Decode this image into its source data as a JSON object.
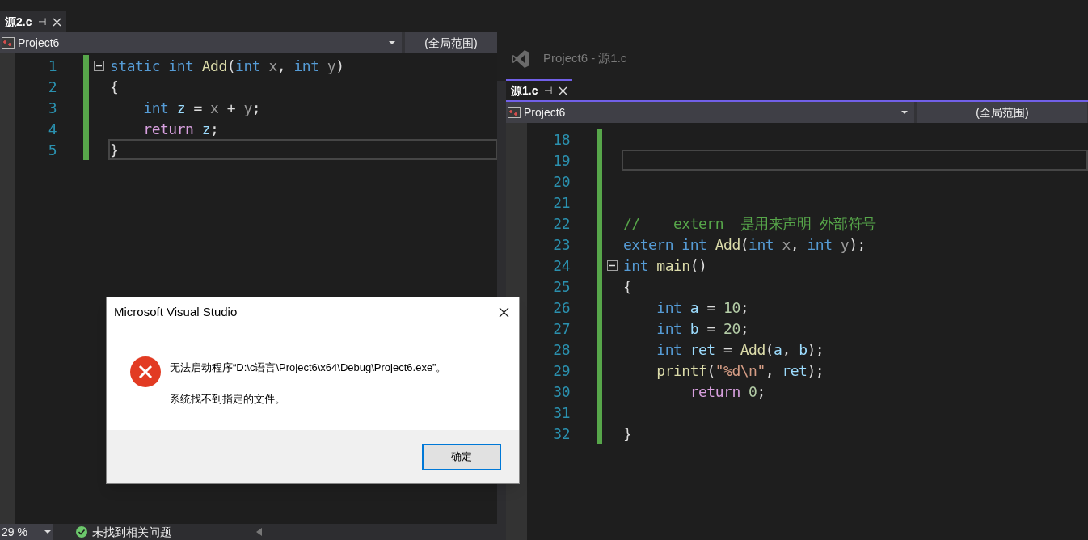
{
  "left_window": {
    "tab": {
      "label": "源2.c",
      "pin": "⊣",
      "selected": true
    },
    "nav": {
      "project": "Project6",
      "scope": "(全局范围)"
    },
    "lines": [
      {
        "number": "1",
        "fold": true,
        "current": false,
        "tokens": [
          {
            "kind": "keyword",
            "text": "static"
          },
          {
            "kind": "keyword",
            "text": " int"
          },
          {
            "kind": "function",
            "text": " Add"
          },
          {
            "kind": "plain",
            "text": "("
          },
          {
            "kind": "keyword",
            "text": "int"
          },
          {
            "kind": "param",
            "text": " x"
          },
          {
            "kind": "plain",
            "text": ", "
          },
          {
            "kind": "keyword",
            "text": "int"
          },
          {
            "kind": "param",
            "text": " y"
          },
          {
            "kind": "plain",
            "text": ")"
          }
        ]
      },
      {
        "number": "2",
        "fold": false,
        "current": false,
        "tokens": [
          {
            "kind": "plain",
            "text": "{"
          }
        ]
      },
      {
        "number": "3",
        "fold": false,
        "current": false,
        "tokens": [
          {
            "kind": "keyword",
            "text": "    int"
          },
          {
            "kind": "variable",
            "text": " z"
          },
          {
            "kind": "plain",
            "text": " = "
          },
          {
            "kind": "param",
            "text": "x"
          },
          {
            "kind": "plain",
            "text": " + "
          },
          {
            "kind": "param",
            "text": "y"
          },
          {
            "kind": "plain",
            "text": ";"
          }
        ]
      },
      {
        "number": "4",
        "fold": false,
        "current": false,
        "tokens": [
          {
            "kind": "control",
            "text": "    return"
          },
          {
            "kind": "variable",
            "text": " z"
          },
          {
            "kind": "plain",
            "text": ";"
          }
        ]
      },
      {
        "number": "5",
        "fold": false,
        "current": true,
        "tokens": [
          {
            "kind": "plain",
            "text": "}"
          }
        ]
      }
    ],
    "status": {
      "zoom": "29 %",
      "issues": "未找到相关问题"
    }
  },
  "right_window": {
    "title": "Project6 - 源1.c",
    "tab": {
      "label": "源1.c",
      "pin": "⊣",
      "selected": true
    },
    "nav": {
      "project": "Project6",
      "scope": "(全局范围)"
    },
    "lines": [
      {
        "number": "18",
        "fold": false,
        "current": false
      },
      {
        "number": "19",
        "fold": false,
        "current": true
      },
      {
        "number": "20",
        "fold": false,
        "current": false
      },
      {
        "number": "21",
        "fold": false,
        "current": false
      },
      {
        "number": "22",
        "fold": false,
        "current": false,
        "tokens": [
          {
            "kind": "comment",
            "text": "//    extern  是用来声明 外部符号"
          }
        ]
      },
      {
        "number": "23",
        "fold": false,
        "current": false,
        "tokens": [
          {
            "kind": "keyword",
            "text": "extern"
          },
          {
            "kind": "keyword",
            "text": " int"
          },
          {
            "kind": "function",
            "text": " Add"
          },
          {
            "kind": "plain",
            "text": "("
          },
          {
            "kind": "keyword",
            "text": "int"
          },
          {
            "kind": "param",
            "text": " x"
          },
          {
            "kind": "plain",
            "text": ", "
          },
          {
            "kind": "keyword",
            "text": "int"
          },
          {
            "kind": "param",
            "text": " y"
          },
          {
            "kind": "plain",
            "text": ");"
          }
        ]
      },
      {
        "number": "24",
        "fold": true,
        "current": false,
        "tokens": [
          {
            "kind": "keyword",
            "text": "int"
          },
          {
            "kind": "function",
            "text": " main"
          },
          {
            "kind": "plain",
            "text": "()"
          }
        ]
      },
      {
        "number": "25",
        "fold": false,
        "current": false,
        "tokens": [
          {
            "kind": "plain",
            "text": "{"
          }
        ]
      },
      {
        "number": "26",
        "fold": false,
        "current": false,
        "tokens": [
          {
            "kind": "keyword",
            "text": "    int"
          },
          {
            "kind": "variable",
            "text": " a"
          },
          {
            "kind": "plain",
            "text": " = "
          },
          {
            "kind": "number",
            "text": "10"
          },
          {
            "kind": "plain",
            "text": ";"
          }
        ]
      },
      {
        "number": "27",
        "fold": false,
        "current": false,
        "tokens": [
          {
            "kind": "keyword",
            "text": "    int"
          },
          {
            "kind": "variable",
            "text": " b"
          },
          {
            "kind": "plain",
            "text": " = "
          },
          {
            "kind": "number",
            "text": "20"
          },
          {
            "kind": "plain",
            "text": ";"
          }
        ]
      },
      {
        "number": "28",
        "fold": false,
        "current": false,
        "tokens": [
          {
            "kind": "keyword",
            "text": "    int"
          },
          {
            "kind": "variable",
            "text": " ret"
          },
          {
            "kind": "plain",
            "text": " = "
          },
          {
            "kind": "function",
            "text": "Add"
          },
          {
            "kind": "plain",
            "text": "("
          },
          {
            "kind": "variable",
            "text": "a"
          },
          {
            "kind": "plain",
            "text": ", "
          },
          {
            "kind": "variable",
            "text": "b"
          },
          {
            "kind": "plain",
            "text": ");"
          }
        ]
      },
      {
        "number": "29",
        "fold": false,
        "current": false,
        "tokens": [
          {
            "kind": "function",
            "text": "    printf"
          },
          {
            "kind": "plain",
            "text": "("
          },
          {
            "kind": "string",
            "text": "\"%d\\n\""
          },
          {
            "kind": "plain",
            "text": ", "
          },
          {
            "kind": "variable",
            "text": "ret"
          },
          {
            "kind": "plain",
            "text": ");"
          }
        ]
      },
      {
        "number": "30",
        "fold": false,
        "current": false,
        "tokens": [
          {
            "kind": "control",
            "text": "        return"
          },
          {
            "kind": "number",
            "text": " 0"
          },
          {
            "kind": "plain",
            "text": ";"
          }
        ]
      },
      {
        "number": "31",
        "fold": false,
        "current": false
      },
      {
        "number": "32",
        "fold": false,
        "current": false,
        "tokens": [
          {
            "kind": "plain",
            "text": "}"
          }
        ]
      }
    ]
  },
  "dialog": {
    "title": "Microsoft Visual Studio",
    "message": "无法启动程序“D:\\c语言\\Project6\\x64\\Debug\\Project6.exe”。",
    "detail": "系统找不到指定的文件。",
    "button": "确定"
  }
}
